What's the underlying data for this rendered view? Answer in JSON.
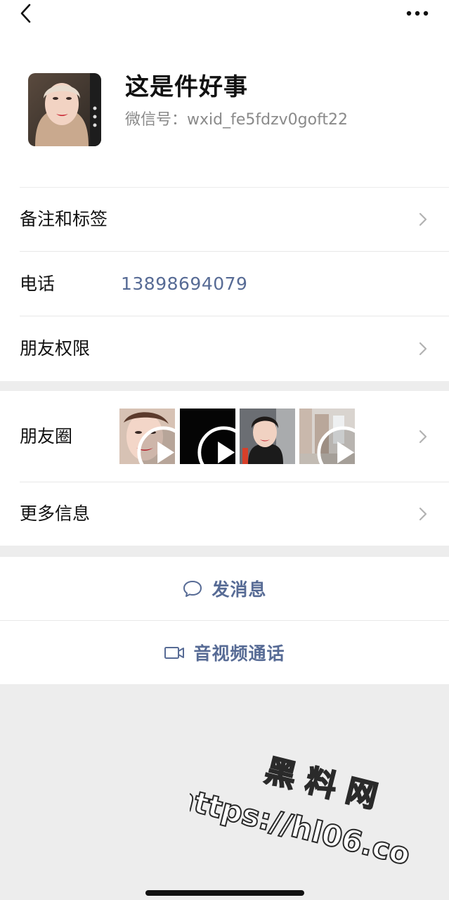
{
  "icons": {
    "back": "chevron-left-icon",
    "more": "more-horizontal-icon",
    "row_arrow": "chevron-right-icon",
    "video_play": "play-icon",
    "message": "chat-bubble-icon",
    "video_call": "video-camera-icon"
  },
  "colors": {
    "link": "#576b95",
    "background": "#ededed",
    "card": "#ffffff"
  },
  "profile": {
    "name": "这是件好事",
    "wechat_id": "微信号：wxid_fe5fdzv0goft22"
  },
  "rows": {
    "remark_tags": {
      "label": "备注和标签"
    },
    "phone": {
      "label": "电话",
      "value": "13898694079"
    },
    "friend_permissions": {
      "label": "朋友权限"
    },
    "moments": {
      "label": "朋友圈",
      "thumbnail_count": 4
    },
    "more_info": {
      "label": "更多信息"
    }
  },
  "actions": {
    "send_message": "发消息",
    "video_call": "音视频通话"
  },
  "watermark": {
    "line1": "黑 料 网",
    "line2": "https://hl06.co"
  }
}
